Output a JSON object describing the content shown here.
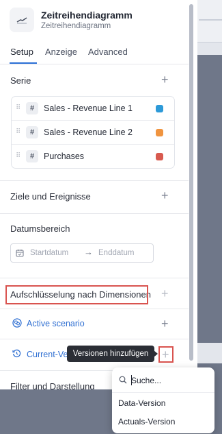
{
  "header": {
    "title": "Zeitreihendiagramm",
    "subtitle": "Zeitreihendiagramm"
  },
  "tabs": [
    {
      "label": "Setup",
      "active": true
    },
    {
      "label": "Anzeige",
      "active": false
    },
    {
      "label": "Advanced",
      "active": false
    }
  ],
  "series_section": {
    "label": "Serie",
    "items": [
      {
        "name": "Sales - Revenue Line 1",
        "color": "#2d9ad8"
      },
      {
        "name": "Sales - Revenue Line 2",
        "color": "#f0943f"
      },
      {
        "name": "Purchases",
        "color": "#d85a4f"
      }
    ]
  },
  "goals_section": {
    "label": "Ziele und Ereignisse"
  },
  "date_section": {
    "label": "Datumsbereich",
    "start_placeholder": "Startdatum",
    "end_placeholder": "Enddatum"
  },
  "dimensions_section": {
    "label": "Aufschlüsselung nach Dimensionen"
  },
  "scenario": {
    "label": "Active scenario"
  },
  "version": {
    "label": "Current-Ve"
  },
  "tooltip": {
    "text": "Versionen hinzufügen"
  },
  "filter_section": {
    "label": "Filter und Darstellung"
  },
  "dropdown": {
    "search_placeholder": "Suche...",
    "items": [
      "Data-Version",
      "Actuals-Version"
    ]
  }
}
